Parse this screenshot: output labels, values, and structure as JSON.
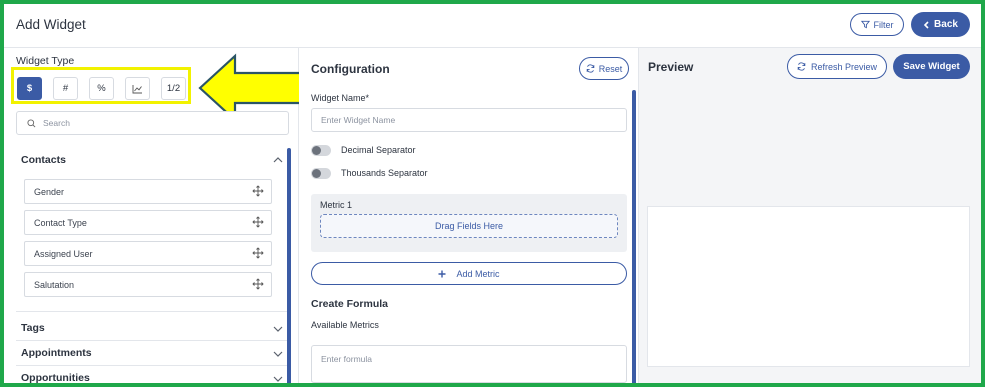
{
  "header": {
    "title": "Add Widget",
    "filter_label": "Filter",
    "back_label": "Back"
  },
  "left": {
    "widget_type_label": "Widget Type",
    "widget_types": [
      {
        "label": "$",
        "active": true
      },
      {
        "label": "#",
        "active": false
      },
      {
        "label": "%",
        "active": false
      },
      {
        "label": "",
        "icon": "line-chart-icon",
        "active": false
      },
      {
        "label": "1/2",
        "active": false
      }
    ],
    "search_placeholder": "Search",
    "sections": [
      {
        "title": "Contacts",
        "expanded": true,
        "fields": [
          "Gender",
          "Contact Type",
          "Assigned User",
          "Salutation"
        ]
      },
      {
        "title": "Tags",
        "expanded": false
      },
      {
        "title": "Appointments",
        "expanded": false
      },
      {
        "title": "Opportunities",
        "expanded": false
      }
    ]
  },
  "config": {
    "title": "Configuration",
    "reset_label": "Reset",
    "widget_name_label": "Widget Name*",
    "widget_name_placeholder": "Enter Widget Name",
    "decimal_separator_label": "Decimal Separator",
    "thousands_separator_label": "Thousands Separator",
    "metric_title": "Metric 1",
    "drop_zone_label": "Drag Fields Here",
    "add_metric_label": "Add Metric",
    "create_formula_title": "Create Formula",
    "available_metrics_label": "Available Metrics",
    "formula_placeholder": "Enter formula"
  },
  "preview": {
    "title": "Preview",
    "refresh_label": "Refresh Preview",
    "save_label": "Save Widget"
  },
  "colors": {
    "accent": "#3b5ba5",
    "frame": "#1fa84a",
    "highlight": "#f2f200"
  }
}
